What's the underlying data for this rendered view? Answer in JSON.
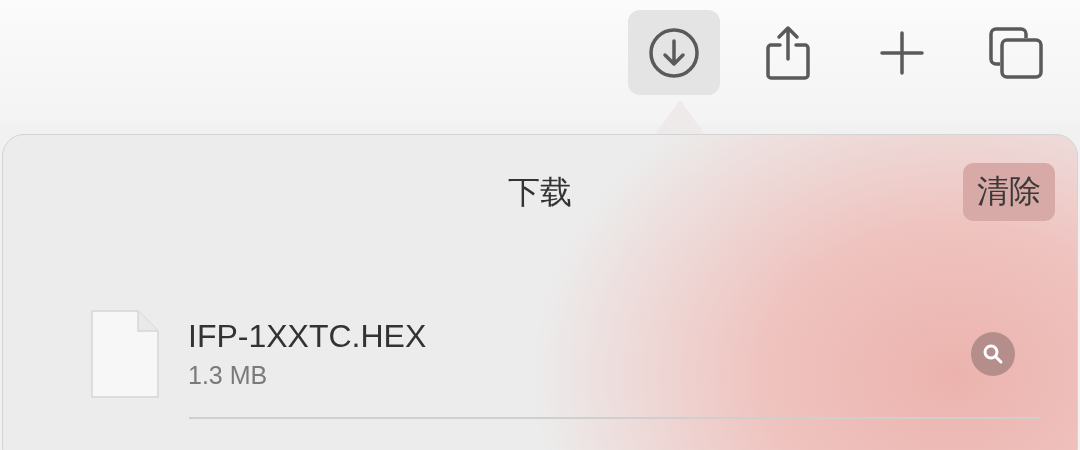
{
  "toolbar": {
    "buttons": [
      {
        "kind": "download",
        "selected": true
      },
      {
        "kind": "share",
        "selected": false
      },
      {
        "kind": "new-tab",
        "selected": false
      },
      {
        "kind": "tabs",
        "selected": false
      }
    ]
  },
  "downloads_popover": {
    "title": "下载",
    "clear_button": "清除",
    "items": [
      {
        "name": "IFP-1XXTC.HEX",
        "size": "1.3 MB"
      }
    ]
  }
}
